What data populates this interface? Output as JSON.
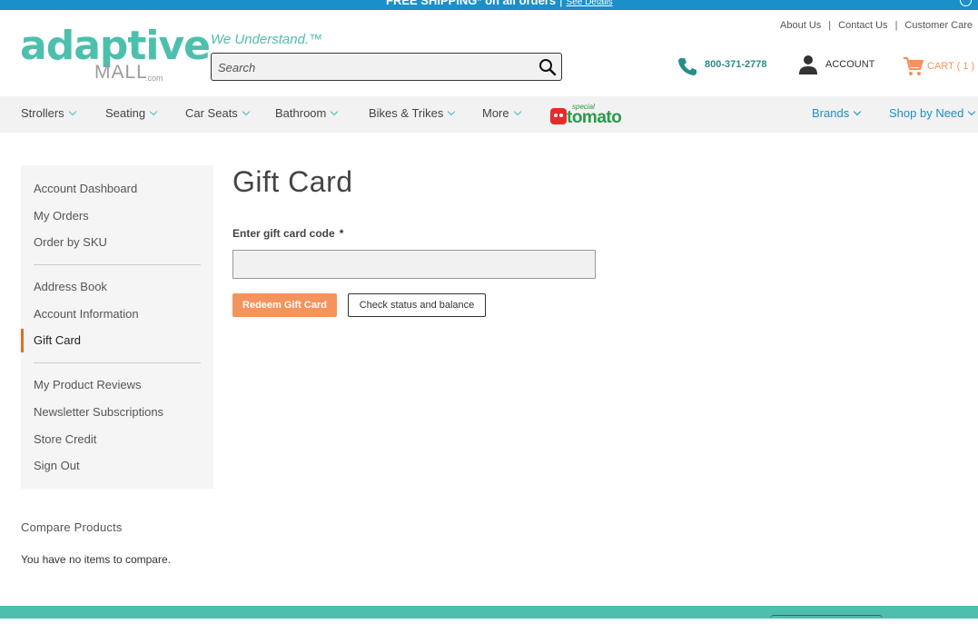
{
  "promo": {
    "text": "FREE SHIPPING* on all orders",
    "separator": "|",
    "link": "See Details"
  },
  "header": {
    "logo_top": "adaptive",
    "logo_bottom": "MALL",
    "logo_suffix": ".com",
    "tagline": "We Understand.™",
    "search_placeholder": "Search",
    "top_links": [
      "About Us",
      "Contact Us",
      "Customer Care"
    ],
    "top_links_separator": "|",
    "phone": "800-371-2778",
    "account_label": "ACCOUNT",
    "cart_label": "CART ( 1 )"
  },
  "nav": {
    "items": [
      "Strollers",
      "Seating",
      "Car Seats",
      "Bathroom",
      "Bikes & Trikes",
      "More"
    ],
    "special_small": "special",
    "special_big": "tomato",
    "right_items": [
      "Brands",
      "Shop by Need"
    ]
  },
  "sidebar": {
    "group1": [
      "Account Dashboard",
      "My Orders",
      "Order by SKU"
    ],
    "group2": [
      "Address Book",
      "Account Information",
      "Gift Card"
    ],
    "group3": [
      "My Product Reviews",
      "Newsletter Subscriptions",
      "Store Credit",
      "Sign Out"
    ],
    "active": "Gift Card"
  },
  "compare": {
    "title": "Compare Products",
    "empty": "You have no items to compare."
  },
  "main": {
    "title": "Gift Card",
    "field_label": "Enter gift card code",
    "required_mark": "*",
    "input_value": "",
    "redeem_label": "Redeem Gift Card",
    "check_label": "Check status and balance"
  },
  "colors": {
    "brand_teal": "#4dbfad",
    "promo_blue": "#1a8fc9",
    "accent_orange": "#f4935c",
    "active_marker": "#e0701f"
  }
}
